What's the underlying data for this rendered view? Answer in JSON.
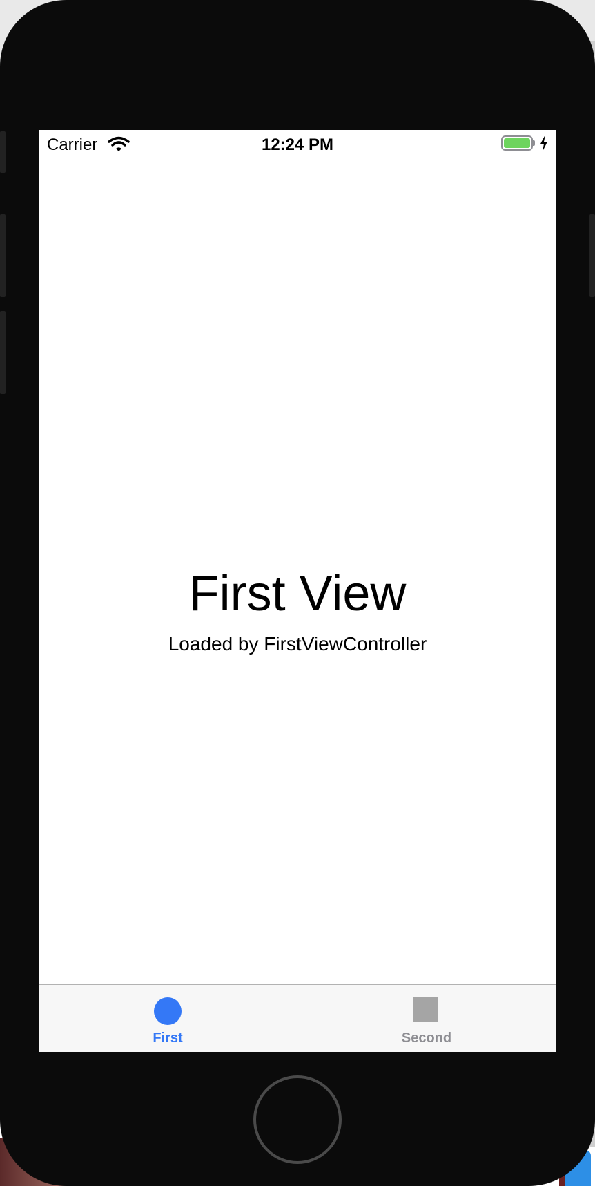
{
  "status_bar": {
    "carrier": "Carrier",
    "time": "12:24 PM",
    "wifi_icon": "wifi-icon",
    "battery_icon": "battery-icon",
    "charging_icon": "charging-bolt-icon",
    "battery_color": "#6ed45e",
    "battery_level": 1.0
  },
  "content": {
    "title": "First View",
    "subtitle": "Loaded by FirstViewController"
  },
  "tab_bar": {
    "selected_index": 0,
    "active_color": "#3478f6",
    "inactive_color": "#8e8e93",
    "tabs": [
      {
        "label": "First",
        "icon": "circle-icon"
      },
      {
        "label": "Second",
        "icon": "square-icon"
      }
    ]
  }
}
